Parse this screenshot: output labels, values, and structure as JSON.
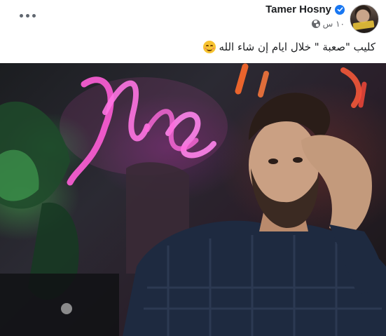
{
  "post": {
    "author": "Tamer Hosny",
    "timestamp": "١٠ س",
    "text": "كليب \"صعبة \" خلال ايام إن شاء الله",
    "icons": {
      "more": "more-options-icon",
      "verified": "verified-badge-icon",
      "privacy": "globe-icon",
      "emoji": "smiling-face-emoji"
    },
    "colors": {
      "verified": "#1877f2",
      "author_text": "#1c1e21",
      "meta_text": "#65676b"
    }
  }
}
